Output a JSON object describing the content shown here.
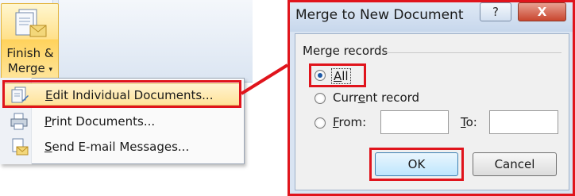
{
  "ribbon": {
    "finish_merge_line1": "Finish &",
    "finish_merge_line2": "Merge",
    "caret": "▾"
  },
  "menu": {
    "items": [
      {
        "label": "Edit Individual Documents...",
        "accel": "E",
        "rest": "dit Individual Documents..."
      },
      {
        "label": "Print Documents...",
        "accel": "P",
        "rest": "rint Documents..."
      },
      {
        "label": "Send E-mail Messages...",
        "accel": "S",
        "rest": "end E-mail Messages..."
      }
    ]
  },
  "dialog": {
    "title": "Merge to New Document",
    "help_button": "?",
    "close_button": "X",
    "group_label": "Merge records",
    "option_all": {
      "accel": "A",
      "rest": "ll",
      "selected": true
    },
    "option_current": {
      "before": "Curr",
      "accel": "e",
      "rest": "nt record",
      "selected": false
    },
    "option_from": {
      "accel": "F",
      "rest": "rom:",
      "selected": false
    },
    "to_label": {
      "accel": "T",
      "rest": "o:"
    },
    "from_value": "",
    "to_value": "",
    "ok_label": "OK",
    "cancel_label": "Cancel"
  },
  "colors": {
    "highlight_red": "#e0141c",
    "menu_hover": "#ffe39a",
    "dialog_frame": "#d9e4f2"
  }
}
